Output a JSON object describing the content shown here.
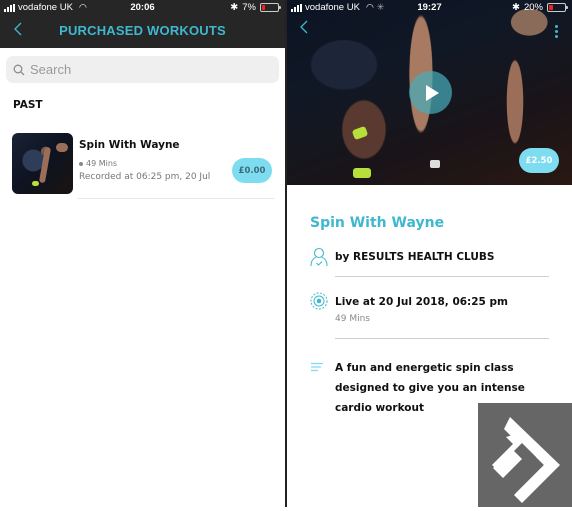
{
  "left_screen": {
    "status_bar": {
      "carrier": "vodafone UK",
      "time": "20:06",
      "battery": "7%",
      "battery_level": 0.07
    },
    "header": {
      "back_icon": "chevron-left-icon",
      "title": "PURCHASED WORKOUTS"
    },
    "search": {
      "placeholder": "Search",
      "value": ""
    },
    "section_label": "PAST",
    "items": [
      {
        "name": "Spin With Wayne",
        "duration": "49 Mins",
        "recorded": "Recorded at 06:25 pm, 20 Jul",
        "price": "£0.00"
      }
    ]
  },
  "right_screen": {
    "status_bar": {
      "carrier": "vodafone UK",
      "time": "19:27",
      "battery": "20%",
      "battery_level": 0.2
    },
    "hero": {
      "back_icon": "chevron-left-icon",
      "more_icon": "more-vertical-icon",
      "play_icon": "play-icon",
      "price": "£2.50"
    },
    "title": "Spin With Wayne",
    "provider": "by RESULTS HEALTH CLUBS",
    "live": "Live at 20 Jul 2018, 06:25 pm",
    "duration": "49 Mins",
    "description": "A fun and energetic spin class designed to give you an intense cardio workout"
  },
  "colors": {
    "accent": "#3fb8cf",
    "price_pill": "#7edcf0",
    "header_bg": "#262626"
  }
}
